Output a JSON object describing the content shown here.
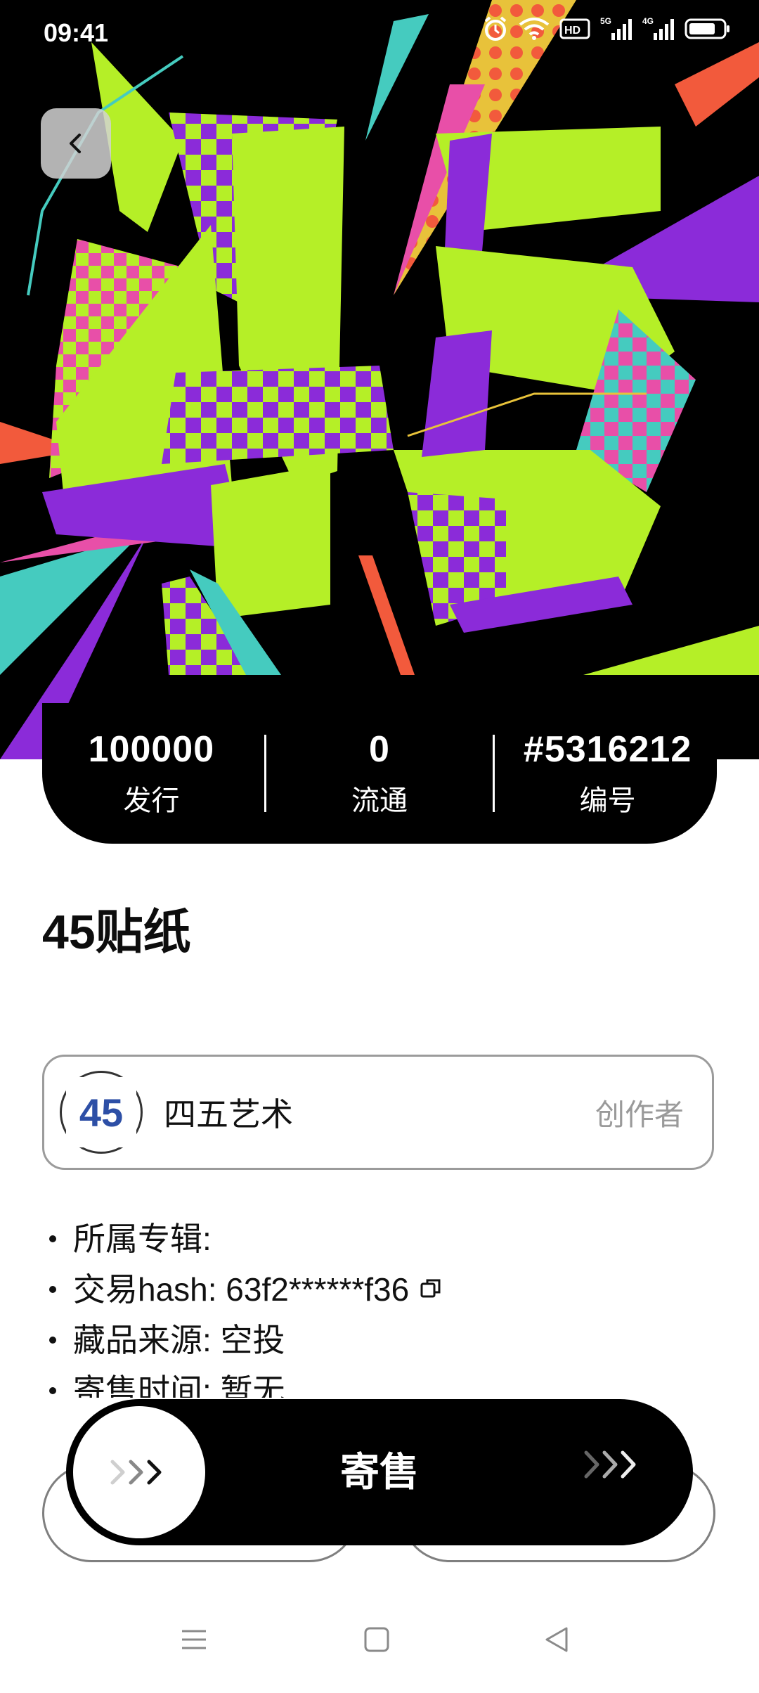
{
  "status_bar": {
    "time": "09:41"
  },
  "hero": {
    "artwork_text": "45",
    "colors": {
      "lime": "#b5ef27",
      "purple": "#8b2bd9",
      "teal": "#45cbbf",
      "pink": "#e84fa8",
      "orange": "#f25a3c"
    }
  },
  "stats": [
    {
      "value": "100000",
      "label": "发行"
    },
    {
      "value": "0",
      "label": "流通"
    },
    {
      "value": "#5316212",
      "label": "编号"
    }
  ],
  "item": {
    "title": "45贴纸"
  },
  "creator": {
    "name": "四五艺术",
    "role": "创作者",
    "avatar_text": "45"
  },
  "details": [
    {
      "label": "所属专辑:",
      "value": ""
    },
    {
      "label": "交易hash:",
      "value": " 63f2******f36",
      "copy": true
    },
    {
      "label": "藏品来源:",
      "value": " 空投"
    },
    {
      "label": "寄售时间:",
      "value": " 暂无"
    }
  ],
  "actions": {
    "sell_label": "寄售"
  }
}
